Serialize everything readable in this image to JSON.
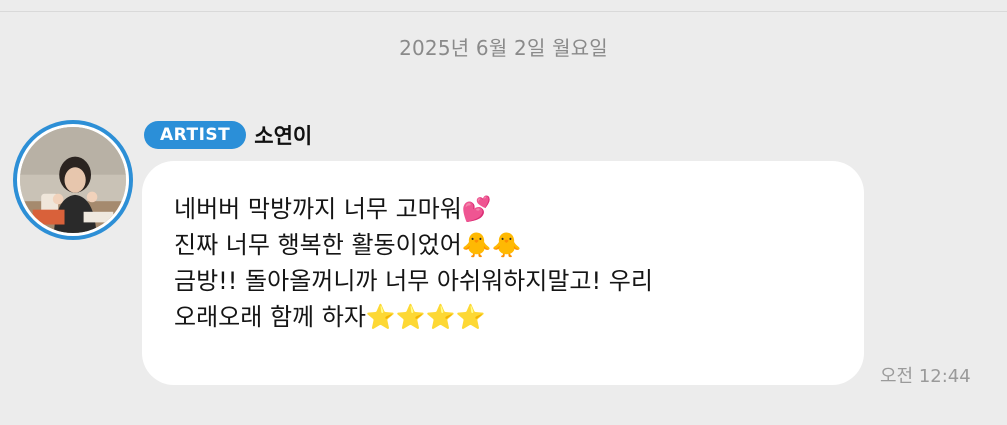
{
  "date_divider": "2025년 6월 2일 월요일",
  "sender": {
    "badge_label": "ARTIST",
    "name": "소연이"
  },
  "message": {
    "lines": [
      "네버버 막방까지 너무 고마워💕",
      "진짜 너무 행복한 활동이었어🐥🐥",
      "금방!! 돌아올꺼니까 너무 아쉬워하지말고! 우리",
      "오래오래 함께 하자⭐⭐⭐⭐"
    ],
    "timestamp": "오전 12:44"
  },
  "colors": {
    "background": "#ececec",
    "bubble": "#ffffff",
    "accent": "#2b8fd8",
    "secondary_text": "#8a8a8a"
  }
}
